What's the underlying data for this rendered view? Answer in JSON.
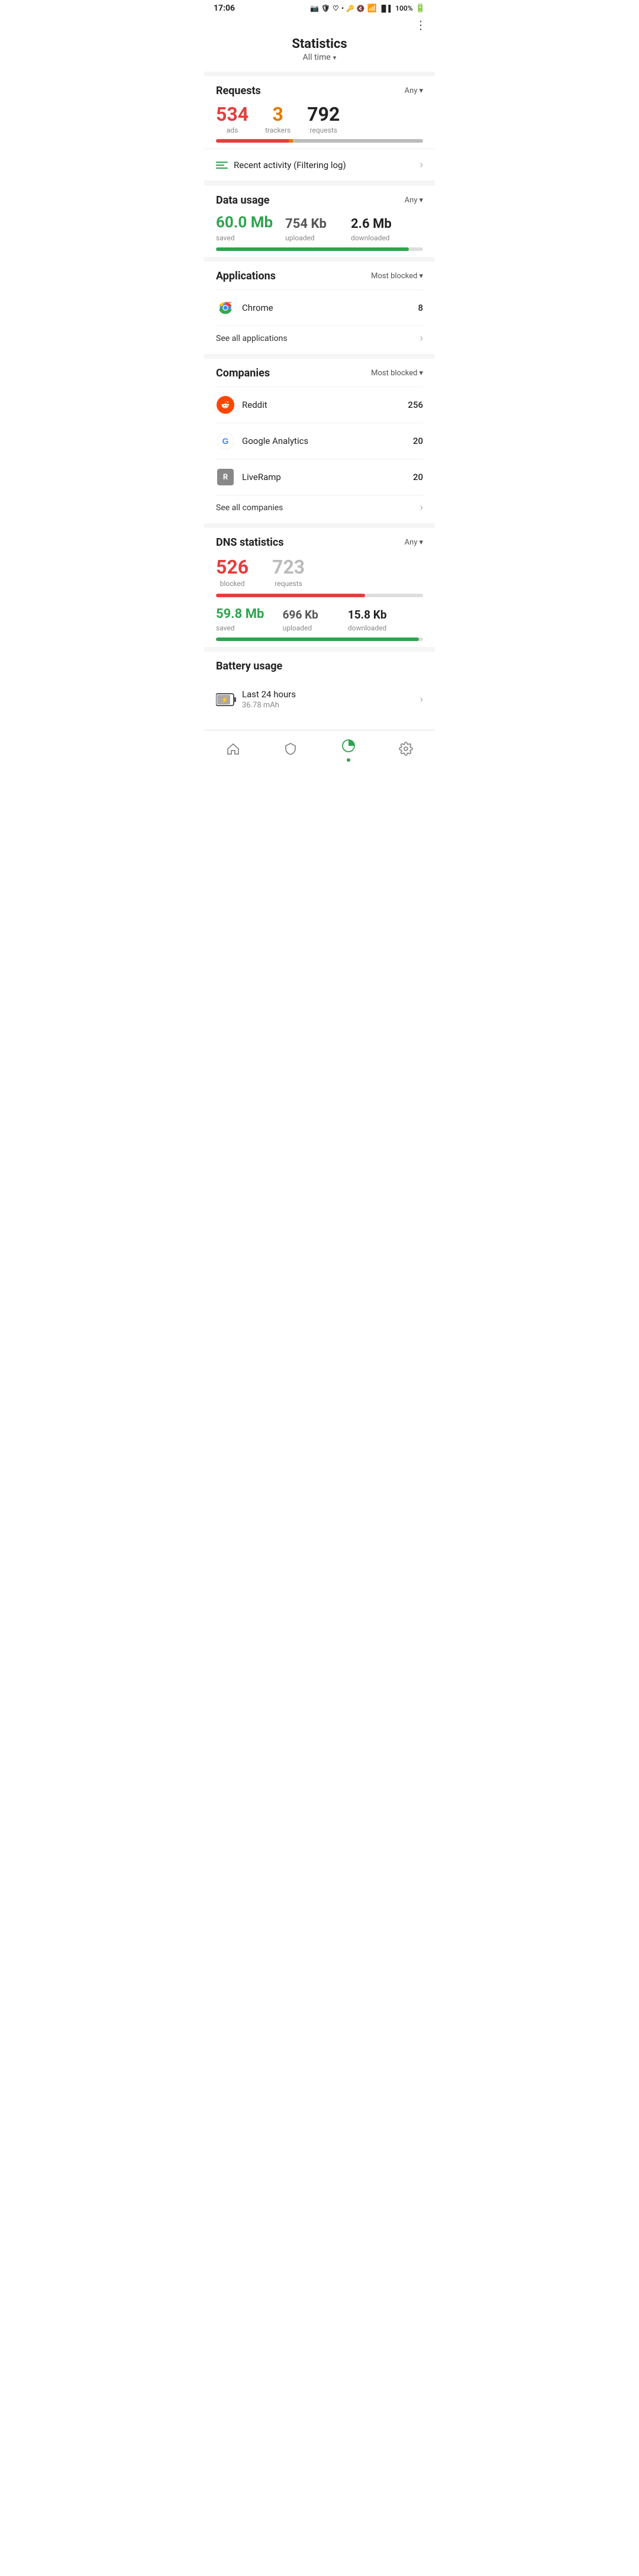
{
  "status": {
    "time": "17:06",
    "battery": "100%"
  },
  "header": {
    "title": "Statistics",
    "subtitle": "All time",
    "more_icon": "⋮"
  },
  "requests": {
    "section_title": "Requests",
    "filter_label": "Any",
    "ads_value": "534",
    "ads_label": "ads",
    "trackers_value": "3",
    "trackers_label": "trackers",
    "requests_value": "792",
    "requests_label": "requests",
    "bar_ads_pct": 35,
    "bar_trackers_pct": 2,
    "bar_rest_pct": 63
  },
  "activity": {
    "label": "Recent activity (Filtering log)"
  },
  "data_usage": {
    "section_title": "Data usage",
    "filter_label": "Any",
    "saved_value": "60.0 Mb",
    "saved_label": "saved",
    "uploaded_value": "754 Kb",
    "uploaded_label": "uploaded",
    "downloaded_value": "2.6 Mb",
    "downloaded_label": "downloaded",
    "bar_pct": 93
  },
  "applications": {
    "section_title": "Applications",
    "filter_label": "Most blocked",
    "items": [
      {
        "name": "Chrome",
        "count": "8",
        "icon_type": "chrome"
      }
    ],
    "see_all_label": "See all applications"
  },
  "companies": {
    "section_title": "Companies",
    "filter_label": "Most blocked",
    "items": [
      {
        "name": "Reddit",
        "count": "256",
        "icon_type": "reddit"
      },
      {
        "name": "Google Analytics",
        "count": "20",
        "icon_type": "google"
      },
      {
        "name": "LiveRamp",
        "count": "20",
        "icon_type": "liveramp"
      }
    ],
    "see_all_label": "See all companies"
  },
  "dns_statistics": {
    "section_title": "DNS statistics",
    "filter_label": "Any",
    "blocked_value": "526",
    "blocked_label": "blocked",
    "requests_value": "723",
    "requests_label": "requests",
    "bar_pct": 72,
    "saved_value": "59.8 Mb",
    "saved_label": "saved",
    "uploaded_value": "696 Kb",
    "uploaded_label": "uploaded",
    "downloaded_value": "15.8 Kb",
    "downloaded_label": "downloaded",
    "bar2_pct": 98
  },
  "battery": {
    "section_title": "Battery usage",
    "item_title": "Last 24 hours",
    "item_subtitle": "36.78 mAh"
  },
  "bottom_nav": {
    "items": [
      {
        "label": "home",
        "icon": "⌂",
        "active": false
      },
      {
        "label": "shield",
        "icon": "🛡",
        "active": false
      },
      {
        "label": "chart",
        "icon": "◑",
        "active": true
      },
      {
        "label": "settings",
        "icon": "⚙",
        "active": false
      }
    ]
  }
}
